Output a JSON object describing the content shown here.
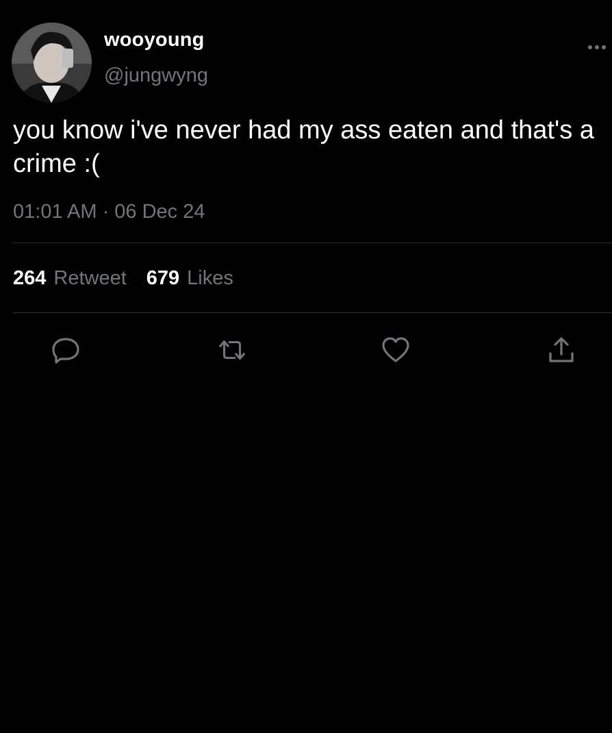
{
  "author": {
    "display_name": "wooyoung",
    "handle": "@jungwyng",
    "avatar_icon": "profile-photo"
  },
  "tweet": {
    "text": "you know i've never had my ass eaten and that's a crime :(",
    "timestamp": "01:01 AM · 06 Dec 24"
  },
  "stats": {
    "retweets_count": "264",
    "retweets_label": "Retweet",
    "likes_count": "679",
    "likes_label": "Likes"
  },
  "actions": [
    {
      "name": "reply",
      "icon": "speech-bubble-icon"
    },
    {
      "name": "retweet",
      "icon": "retweet-arrows-icon"
    },
    {
      "name": "like",
      "icon": "heart-icon"
    },
    {
      "name": "share",
      "icon": "share-upload-icon"
    }
  ],
  "colors": {
    "background": "#000000",
    "primary_text": "#ffffff",
    "secondary_text": "#71767b",
    "divider": "#2f3336",
    "icon": "#71767b"
  }
}
